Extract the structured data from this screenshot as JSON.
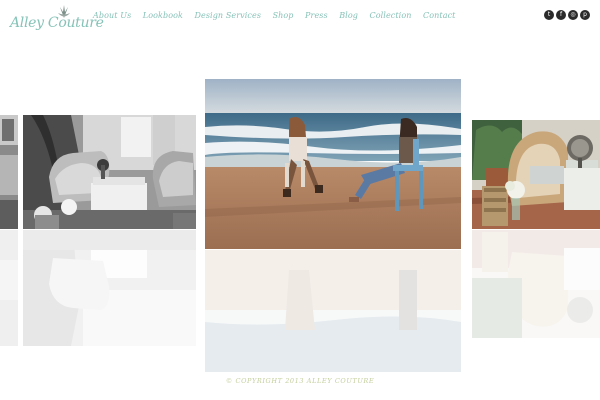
{
  "brand": {
    "name": "Alley Couture",
    "accent_color": "#86c2b7"
  },
  "nav": {
    "items": [
      {
        "label": "About Us"
      },
      {
        "label": "Lookbook"
      },
      {
        "label": "Design Services"
      },
      {
        "label": "Shop"
      },
      {
        "label": "Press"
      },
      {
        "label": "Blog"
      },
      {
        "label": "Collection"
      },
      {
        "label": "Contact"
      }
    ]
  },
  "social": {
    "items": [
      {
        "icon": "twitter-icon",
        "glyph": "t"
      },
      {
        "icon": "facebook-icon",
        "glyph": "f"
      },
      {
        "icon": "instagram-icon",
        "glyph": "◎"
      },
      {
        "icon": "pinterest-icon",
        "glyph": "p"
      }
    ]
  },
  "gallery": {
    "slides": [
      {
        "name": "vintage-lounge-photo",
        "style": "grayscale"
      },
      {
        "name": "beach-chairs-photo",
        "style": "color"
      },
      {
        "name": "wicker-patio-photo",
        "style": "color"
      }
    ]
  },
  "footer": {
    "copyright": "© Copyright 2013 Alley Couture"
  }
}
